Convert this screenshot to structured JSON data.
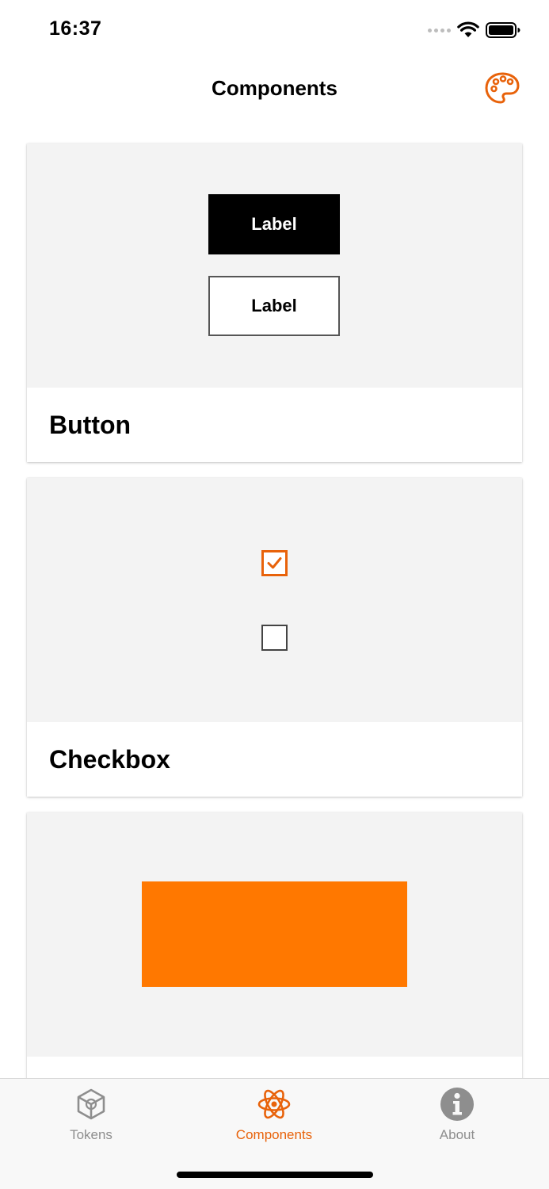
{
  "status_bar": {
    "time": "16:37"
  },
  "nav": {
    "title": "Components",
    "action_icon": "palette-icon"
  },
  "colors": {
    "accent": "#e8620a",
    "brand_orange": "#ff7800",
    "preview_bg": "#f3f3f3",
    "tab_inactive": "#8e8e8e"
  },
  "cards": [
    {
      "title": "Button",
      "preview": {
        "primary_button_label": "Label",
        "secondary_button_label": "Label"
      }
    },
    {
      "title": "Checkbox",
      "preview": {
        "checked": true,
        "unchecked": false
      }
    },
    {
      "title": "",
      "preview": {
        "swatch_color": "#ff7800"
      }
    }
  ],
  "tab_bar": {
    "selected": "Components",
    "tabs": [
      {
        "label": "Tokens",
        "icon": "cube-icon"
      },
      {
        "label": "Components",
        "icon": "atom-icon"
      },
      {
        "label": "About",
        "icon": "info-icon"
      }
    ]
  }
}
